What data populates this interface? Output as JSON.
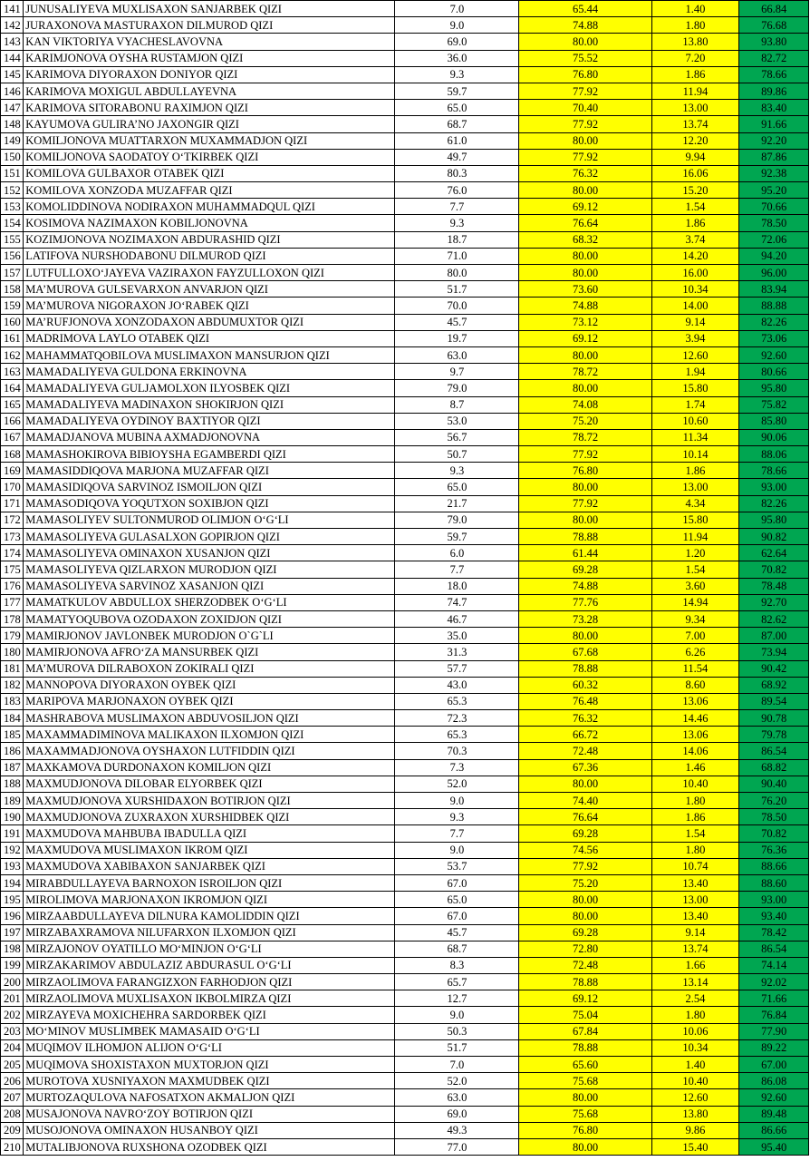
{
  "colors": {
    "yellow_fill": "#ffff00",
    "green_fill": "#00a651",
    "grid": "#000000"
  },
  "rows": [
    [
      "141",
      "JUNUSALIYEVA MUXLISAXON SANJARBEK QIZI",
      "7.0",
      "65.44",
      "1.40",
      "66.84"
    ],
    [
      "142",
      "JURAXONOVA MASTURAXON DILMUROD QIZI",
      "9.0",
      "74.88",
      "1.80",
      "76.68"
    ],
    [
      "143",
      "KAN VIKTORIYA VYACHESLAVOVNA",
      "69.0",
      "80.00",
      "13.80",
      "93.80"
    ],
    [
      "144",
      "KARIMJONOVA OYSHA RUSTAMJON QIZI",
      "36.0",
      "75.52",
      "7.20",
      "82.72"
    ],
    [
      "145",
      "KARIMOVA DIYORAXON DONIYOR QIZI",
      "9.3",
      "76.80",
      "1.86",
      "78.66"
    ],
    [
      "146",
      "KARIMOVA MOXIGUL ABDULLAYEVNA",
      "59.7",
      "77.92",
      "11.94",
      "89.86"
    ],
    [
      "147",
      "KARIMOVA SITORABONU RAXIMJON QIZI",
      "65.0",
      "70.40",
      "13.00",
      "83.40"
    ],
    [
      "148",
      "KAYUMOVA GULIRA’NO JAXONGIR QIZI",
      "68.7",
      "77.92",
      "13.74",
      "91.66"
    ],
    [
      "149",
      "KOMILJONOVA MUATTARXON MUXAMMADJON QIZI",
      "61.0",
      "80.00",
      "12.20",
      "92.20"
    ],
    [
      "150",
      "KOMILJONOVA SAODATOY O‘TKIRBEK QIZI",
      "49.7",
      "77.92",
      "9.94",
      "87.86"
    ],
    [
      "151",
      "KOMILOVA GULBAXOR OTABEK QIZI",
      "80.3",
      "76.32",
      "16.06",
      "92.38"
    ],
    [
      "152",
      "KOMILOVA XONZODA MUZAFFAR QIZI",
      "76.0",
      "80.00",
      "15.20",
      "95.20"
    ],
    [
      "153",
      "KOMOLIDDINOVA NODIRAXON MUHAMMADQUL QIZI",
      "7.7",
      "69.12",
      "1.54",
      "70.66"
    ],
    [
      "154",
      "KOSIMOVA NAZIMAXON KOBILJONOVNA",
      "9.3",
      "76.64",
      "1.86",
      "78.50"
    ],
    [
      "155",
      "KOZIMJONOVA NOZIMAXON ABDURASHID QIZI",
      "18.7",
      "68.32",
      "3.74",
      "72.06"
    ],
    [
      "156",
      "LATIFOVA NURSHODABONU DILMUROD QIZI",
      "71.0",
      "80.00",
      "14.20",
      "94.20"
    ],
    [
      "157",
      "LUTFULLOXO‘JAYEVA VAZIRAXON FAYZULLOXON QIZI",
      "80.0",
      "80.00",
      "16.00",
      "96.00"
    ],
    [
      "158",
      "MA’MUROVA GULSEVARXON ANVARJON QIZI",
      "51.7",
      "73.60",
      "10.34",
      "83.94"
    ],
    [
      "159",
      "MA’MUROVA NIGORAXON JO‘RABEK QIZI",
      "70.0",
      "74.88",
      "14.00",
      "88.88"
    ],
    [
      "160",
      "MA’RUFJONOVA XONZODAXON ABDUMUXTOR QIZI",
      "45.7",
      "73.12",
      "9.14",
      "82.26"
    ],
    [
      "161",
      "MADRIMOVA LAYLO OTABEK QIZI",
      "19.7",
      "69.12",
      "3.94",
      "73.06"
    ],
    [
      "162",
      "MAHAMMATQOBILOVA MUSLIMAXON MANSURJON QIZI",
      "63.0",
      "80.00",
      "12.60",
      "92.60"
    ],
    [
      "163",
      "MAMADALIYEVA GULDONA ERKINOVNA",
      "9.7",
      "78.72",
      "1.94",
      "80.66"
    ],
    [
      "164",
      "MAMADALIYEVA GULJAMOLXON ILYOSBEK QIZI",
      "79.0",
      "80.00",
      "15.80",
      "95.80"
    ],
    [
      "165",
      "MAMADALIYEVA MADINAXON SHOKIRJON QIZI",
      "8.7",
      "74.08",
      "1.74",
      "75.82"
    ],
    [
      "166",
      "MAMADALIYEVA OYDINOY BAXTIYOR QIZI",
      "53.0",
      "75.20",
      "10.60",
      "85.80"
    ],
    [
      "167",
      "MAMADJANOVA MUBINA AXMADJONOVNA",
      "56.7",
      "78.72",
      "11.34",
      "90.06"
    ],
    [
      "168",
      "MAMASHOKIROVA BIBIOYSHA EGAMBERDI QIZI",
      "50.7",
      "77.92",
      "10.14",
      "88.06"
    ],
    [
      "169",
      "MAMASIDDIQOVA MARJONA MUZAFFAR QIZI",
      "9.3",
      "76.80",
      "1.86",
      "78.66"
    ],
    [
      "170",
      "MAMASIDIQOVA SARVINOZ ISMOILJON QIZI",
      "65.0",
      "80.00",
      "13.00",
      "93.00"
    ],
    [
      "171",
      "MAMASODIQOVA YOQUTXON SOXIBJON QIZI",
      "21.7",
      "77.92",
      "4.34",
      "82.26"
    ],
    [
      "172",
      "MAMASOLIYEV SULTONMUROD OLIMJON O‘G‘LI",
      "79.0",
      "80.00",
      "15.80",
      "95.80"
    ],
    [
      "173",
      "MAMASOLIYEVA GULASALXON GOPIRJON QIZI",
      "59.7",
      "78.88",
      "11.94",
      "90.82"
    ],
    [
      "174",
      "MAMASOLIYEVA OMINAXON XUSANJON QIZI",
      "6.0",
      "61.44",
      "1.20",
      "62.64"
    ],
    [
      "175",
      "MAMASOLIYEVA QIZLARXON MURODJON QIZI",
      "7.7",
      "69.28",
      "1.54",
      "70.82"
    ],
    [
      "176",
      "MAMASOLIYEVA SARVINOZ XASANJON QIZI",
      "18.0",
      "74.88",
      "3.60",
      "78.48"
    ],
    [
      "177",
      "MAMATKULOV ABDULLOX SHERZODBEK O‘G‘LI",
      "74.7",
      "77.76",
      "14.94",
      "92.70"
    ],
    [
      "178",
      "MAMATYOQUBOVA OZODAXON ZOXIDJON QIZI",
      "46.7",
      "73.28",
      "9.34",
      "82.62"
    ],
    [
      "179",
      "MAMIRJONOV JAVLONBEK MURODJON O`G`LI",
      "35.0",
      "80.00",
      "7.00",
      "87.00"
    ],
    [
      "180",
      "MAMIRJONOVA AFRO‘ZA MANSURBEK QIZI",
      "31.3",
      "67.68",
      "6.26",
      "73.94"
    ],
    [
      "181",
      "MA’MUROVA DILRABOXON ZOKIRALI QIZI",
      "57.7",
      "78.88",
      "11.54",
      "90.42"
    ],
    [
      "182",
      "MANNOPOVA DIYORAXON OYBEK QIZI",
      "43.0",
      "60.32",
      "8.60",
      "68.92"
    ],
    [
      "183",
      "MARIPOVA MARJONAXON OYBEK QIZI",
      "65.3",
      "76.48",
      "13.06",
      "89.54"
    ],
    [
      "184",
      "MASHRABOVA MUSLIMAXON ABDUVOSILJON QIZI",
      "72.3",
      "76.32",
      "14.46",
      "90.78"
    ],
    [
      "185",
      "MAXAMMADIMINOVA MALIKAXON ILXOMJON QIZI",
      "65.3",
      "66.72",
      "13.06",
      "79.78"
    ],
    [
      "186",
      "MAXAMMADJONOVA OYSHAXON LUTFIDDIN QIZI",
      "70.3",
      "72.48",
      "14.06",
      "86.54"
    ],
    [
      "187",
      "MAXKAMOVA DURDONAXON KOMILJON QIZI",
      "7.3",
      "67.36",
      "1.46",
      "68.82"
    ],
    [
      "188",
      "MAXMUDJONOVA DILOBAR ELYORBEK QIZI",
      "52.0",
      "80.00",
      "10.40",
      "90.40"
    ],
    [
      "189",
      "MAXMUDJONOVA XURSHIDAXON BOTIRJON QIZI",
      "9.0",
      "74.40",
      "1.80",
      "76.20"
    ],
    [
      "190",
      "MAXMUDJONOVA ZUXRAXON XURSHIDBEK QIZI",
      "9.3",
      "76.64",
      "1.86",
      "78.50"
    ],
    [
      "191",
      "MAXMUDOVA MAHBUBA IBADULLA QIZI",
      "7.7",
      "69.28",
      "1.54",
      "70.82"
    ],
    [
      "192",
      "MAXMUDOVA MUSLIMAXON IKROM QIZI",
      "9.0",
      "74.56",
      "1.80",
      "76.36"
    ],
    [
      "193",
      "MAXMUDOVA XABIBAXON SANJARBEK QIZI",
      "53.7",
      "77.92",
      "10.74",
      "88.66"
    ],
    [
      "194",
      "MIRABDULLAYEVA BARNOXON ISROILJON QIZI",
      "67.0",
      "75.20",
      "13.40",
      "88.60"
    ],
    [
      "195",
      "MIROLIMOVA MARJONAXON IKROMJON QIZI",
      "65.0",
      "80.00",
      "13.00",
      "93.00"
    ],
    [
      "196",
      "MIRZAABDULLAYEVA DILNURA KAMOLIDDIN QIZI",
      "67.0",
      "80.00",
      "13.40",
      "93.40"
    ],
    [
      "197",
      "MIRZABAXRAMOVA NILUFARXON ILXOMJON QIZI",
      "45.7",
      "69.28",
      "9.14",
      "78.42"
    ],
    [
      "198",
      "MIRZAJONOV OYATILLO MO‘MINJON O‘G‘LI",
      "68.7",
      "72.80",
      "13.74",
      "86.54"
    ],
    [
      "199",
      "MIRZAKARIMOV ABDULAZIZ ABDURASUL O‘G‘LI",
      "8.3",
      "72.48",
      "1.66",
      "74.14"
    ],
    [
      "200",
      "MIRZAOLIMOVA FARANGIZXON FARHODJON QIZI",
      "65.7",
      "78.88",
      "13.14",
      "92.02"
    ],
    [
      "201",
      "MIRZAOLIMOVA MUXLISAXON IKBOLMIRZA QIZI",
      "12.7",
      "69.12",
      "2.54",
      "71.66"
    ],
    [
      "202",
      "MIRZAYEVA MOXICHEHRA SARDORBEK QIZI",
      "9.0",
      "75.04",
      "1.80",
      "76.84"
    ],
    [
      "203",
      "MO‘MINOV MUSLIMBEK MAMASAID O‘G‘LI",
      "50.3",
      "67.84",
      "10.06",
      "77.90"
    ],
    [
      "204",
      "MUQIMOV ILHOMJON ALIJON O‘G‘LI",
      "51.7",
      "78.88",
      "10.34",
      "89.22"
    ],
    [
      "205",
      "MUQIMOVA SHOXISTAXON MUXTORJON QIZI",
      "7.0",
      "65.60",
      "1.40",
      "67.00"
    ],
    [
      "206",
      "MUROTOVA XUSNIYAXON MAXMUDBEK QIZI",
      "52.0",
      "75.68",
      "10.40",
      "86.08"
    ],
    [
      "207",
      "MURTOZAQULOVA NAFOSATXON AKMALJON QIZI",
      "63.0",
      "80.00",
      "12.60",
      "92.60"
    ],
    [
      "208",
      "MUSAJONOVA NAVRO‘ZOY BOTIRJON QIZI",
      "69.0",
      "75.68",
      "13.80",
      "89.48"
    ],
    [
      "209",
      "MUSOJONOVA OMINAXON HUSANBOY QIZI",
      "49.3",
      "76.80",
      "9.86",
      "86.66"
    ],
    [
      "210",
      "MUTALIBJONOVA RUXSHONA OZODBEK QIZI",
      "77.0",
      "80.00",
      "15.40",
      "95.40"
    ]
  ]
}
